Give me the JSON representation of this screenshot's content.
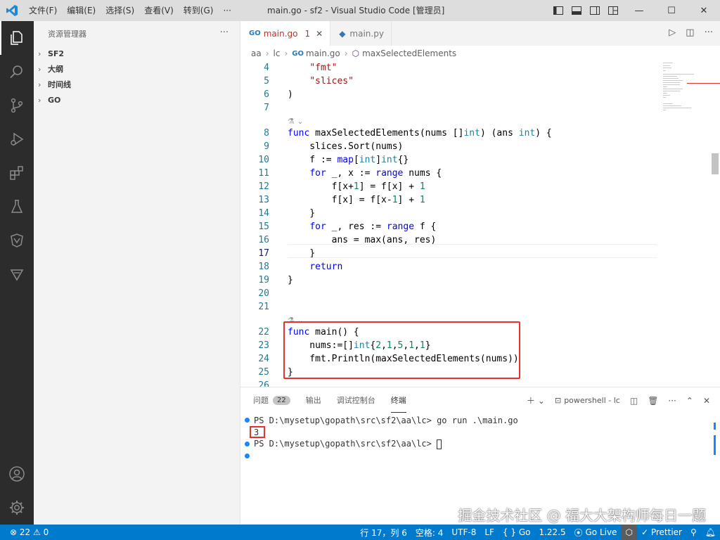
{
  "titlebar": {
    "menu": [
      "文件(F)",
      "编辑(E)",
      "选择(S)",
      "查看(V)",
      "转到(G)",
      "···"
    ],
    "title": "main.go - sf2 - Visual Studio Code [管理员]",
    "minimize": "—",
    "maximize": "☐",
    "close": "✕"
  },
  "sidebar": {
    "header": "资源管理器",
    "more": "···",
    "sections": [
      "SF2",
      "大纲",
      "时间线",
      "GO"
    ]
  },
  "tabs": [
    {
      "label": "main.go",
      "problems": "1",
      "badge": "GO"
    },
    {
      "label": "main.py"
    }
  ],
  "breadcrumb": {
    "items": [
      "aa",
      "lc",
      "main.go",
      "maxSelectedElements"
    ],
    "go_badge": "GO"
  },
  "code": {
    "lines": [
      {
        "n": "4",
        "text": "    \"fmt\""
      },
      {
        "n": "5",
        "text": "    \"slices\""
      },
      {
        "n": "6",
        "text": ")"
      },
      {
        "n": "7",
        "text": ""
      },
      {
        "n": "8",
        "text": "func maxSelectedElements(nums []int) (ans int) {"
      },
      {
        "n": "9",
        "text": "    slices.Sort(nums)"
      },
      {
        "n": "10",
        "text": "    f := map[int]int{}"
      },
      {
        "n": "11",
        "text": "    for _, x := range nums {"
      },
      {
        "n": "12",
        "text": "        f[x+1] = f[x] + 1"
      },
      {
        "n": "13",
        "text": "        f[x] = f[x-1] + 1"
      },
      {
        "n": "14",
        "text": "    }"
      },
      {
        "n": "15",
        "text": "    for _, res := range f {"
      },
      {
        "n": "16",
        "text": "        ans = max(ans, res)"
      },
      {
        "n": "17",
        "text": "    }"
      },
      {
        "n": "18",
        "text": "    return"
      },
      {
        "n": "19",
        "text": "}"
      },
      {
        "n": "20",
        "text": ""
      },
      {
        "n": "21",
        "text": ""
      },
      {
        "n": "22",
        "text": "func main() {"
      },
      {
        "n": "23",
        "text": "    nums:=[]int{2,1,5,1,1}"
      },
      {
        "n": "24",
        "text": "    fmt.Println(maxSelectedElements(nums))"
      },
      {
        "n": "25",
        "text": "}"
      },
      {
        "n": "26",
        "text": ""
      }
    ],
    "current_line": "17"
  },
  "panel": {
    "tabs": [
      "问题",
      "输出",
      "调试控制台",
      "终端"
    ],
    "problems_count": "22",
    "active_tab": "终端",
    "shell": "powershell - lc",
    "terminal": [
      "PS D:\\mysetup\\gopath\\src\\sf2\\aa\\lc> go run .\\main.go",
      "3",
      "PS D:\\mysetup\\gopath\\src\\sf2\\aa\\lc> ",
      ""
    ],
    "watermark": "掘金技术社区 @ 福大大架构师每日一题"
  },
  "statusbar": {
    "errors": "22",
    "warnings": "0",
    "position": "行 17，列 6",
    "spaces": "空格: 4",
    "encoding": "UTF-8",
    "eol": "LF",
    "language": "{ } Go",
    "go_version": "1.22.5",
    "golive": "Go Live",
    "prettier": "Prettier"
  },
  "colors": {
    "accent": "#007acc",
    "keyword": "#0000ff",
    "string": "#a31515",
    "number": "#098658",
    "highlight_box": "#e8312f"
  }
}
